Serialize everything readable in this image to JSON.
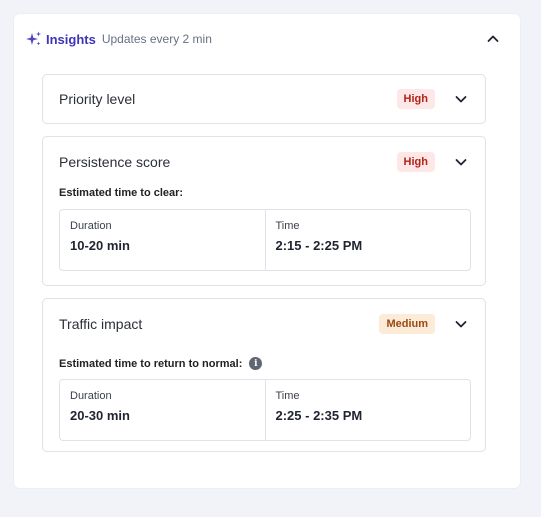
{
  "header": {
    "title": "Insights",
    "subtitle": "Updates every 2 min"
  },
  "items": [
    {
      "title": "Priority level",
      "badge": "High"
    },
    {
      "title": "Persistence score",
      "badge": "High",
      "estimate_label": "Estimated time to clear:",
      "duration_label": "Duration",
      "duration_value": "10-20 min",
      "time_label": "Time",
      "time_value": "2:15 - 2:25 PM"
    },
    {
      "title": "Traffic impact",
      "badge": "Medium",
      "estimate_label": "Estimated time to return to normal:",
      "duration_label": "Duration",
      "duration_value": "20-30 min",
      "time_label": "Time",
      "time_value": "2:25 - 2:35 PM"
    }
  ],
  "icons": {
    "header": "sparkle-icon",
    "collapse": "chevron-up-icon",
    "expand": "chevron-down-icon",
    "info": "info-icon"
  },
  "colors": {
    "accent": "#3b35b8",
    "high_bg": "#fde7e7",
    "high_text": "#b42318",
    "medium_bg": "#fdebd9",
    "medium_text": "#9a4a10"
  }
}
